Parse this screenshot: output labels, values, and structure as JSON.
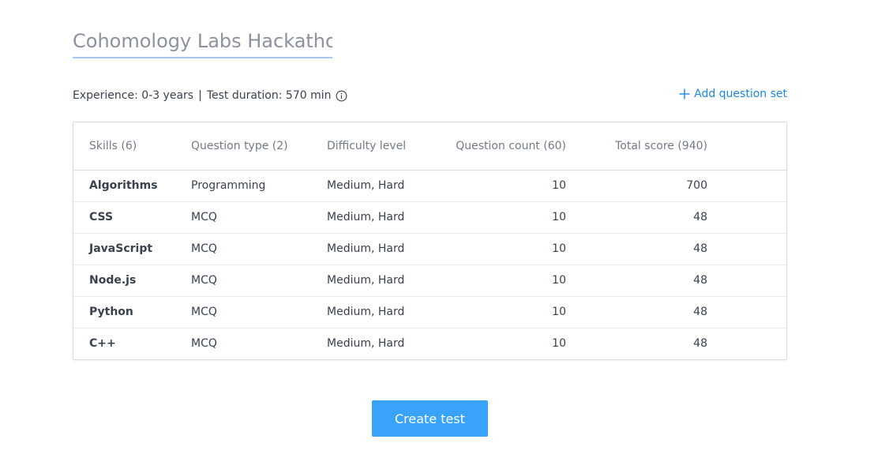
{
  "test": {
    "title": "Cohomology Labs Hackathon"
  },
  "meta": {
    "experience": "Experience: 0-3 years",
    "separator": "|",
    "duration": "Test duration: 570 min",
    "info_icon": "info-circle-icon"
  },
  "actions": {
    "add_question_set": "Add question set",
    "add_icon": "plus-icon",
    "create_test": "Create test"
  },
  "table": {
    "headers": {
      "skills": "Skills (6)",
      "question_type": "Question type (2)",
      "difficulty": "Difficulty level",
      "question_count": "Question count (60)",
      "total_score": "Total score (940)"
    },
    "rows": [
      {
        "skill": "Algorithms",
        "type": "Programming",
        "difficulty": "Medium, Hard",
        "count": "10",
        "score": "700"
      },
      {
        "skill": "CSS",
        "type": "MCQ",
        "difficulty": "Medium, Hard",
        "count": "10",
        "score": "48"
      },
      {
        "skill": "JavaScript",
        "type": "MCQ",
        "difficulty": "Medium, Hard",
        "count": "10",
        "score": "48"
      },
      {
        "skill": "Node.js",
        "type": "MCQ",
        "difficulty": "Medium, Hard",
        "count": "10",
        "score": "48"
      },
      {
        "skill": "Python",
        "type": "MCQ",
        "difficulty": "Medium, Hard",
        "count": "10",
        "score": "48"
      },
      {
        "skill": "C++",
        "type": "MCQ",
        "difficulty": "Medium, Hard",
        "count": "10",
        "score": "48"
      }
    ]
  },
  "colors": {
    "accent": "#1a88e6",
    "button": "#39a3f9",
    "title_underline": "#a8c8ec"
  }
}
